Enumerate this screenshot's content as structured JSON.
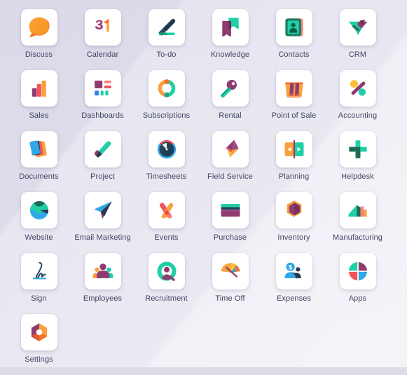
{
  "launcher": {
    "background_color": "#dedbe8",
    "tile_background": "#ffffff",
    "label_color": "#3f4463",
    "columns": 6,
    "apps": [
      {
        "label": "Discuss",
        "icon": "discuss-icon"
      },
      {
        "label": "Calendar",
        "icon": "calendar-icon"
      },
      {
        "label": "To-do",
        "icon": "todo-icon"
      },
      {
        "label": "Knowledge",
        "icon": "knowledge-icon"
      },
      {
        "label": "Contacts",
        "icon": "contacts-icon"
      },
      {
        "label": "CRM",
        "icon": "crm-icon"
      },
      {
        "label": "Sales",
        "icon": "sales-icon"
      },
      {
        "label": "Dashboards",
        "icon": "dashboards-icon"
      },
      {
        "label": "Subscriptions",
        "icon": "subscriptions-icon"
      },
      {
        "label": "Rental",
        "icon": "rental-icon"
      },
      {
        "label": "Point of Sale",
        "icon": "point-of-sale-icon"
      },
      {
        "label": "Accounting",
        "icon": "accounting-icon"
      },
      {
        "label": "Documents",
        "icon": "documents-icon"
      },
      {
        "label": "Project",
        "icon": "project-icon"
      },
      {
        "label": "Timesheets",
        "icon": "timesheets-icon"
      },
      {
        "label": "Field Service",
        "icon": "field-service-icon"
      },
      {
        "label": "Planning",
        "icon": "planning-icon"
      },
      {
        "label": "Helpdesk",
        "icon": "helpdesk-icon"
      },
      {
        "label": "Website",
        "icon": "website-icon"
      },
      {
        "label": "Email Marketing",
        "icon": "email-marketing-icon"
      },
      {
        "label": "Events",
        "icon": "events-icon"
      },
      {
        "label": "Purchase",
        "icon": "purchase-icon"
      },
      {
        "label": "Inventory",
        "icon": "inventory-icon"
      },
      {
        "label": "Manufacturing",
        "icon": "manufacturing-icon"
      },
      {
        "label": "Sign",
        "icon": "sign-icon"
      },
      {
        "label": "Employees",
        "icon": "employees-icon"
      },
      {
        "label": "Recruitment",
        "icon": "recruitment-icon"
      },
      {
        "label": "Time Off",
        "icon": "time-off-icon"
      },
      {
        "label": "Expenses",
        "icon": "expenses-icon"
      },
      {
        "label": "Apps",
        "icon": "apps-icon"
      },
      {
        "label": "Settings",
        "icon": "settings-icon"
      }
    ],
    "palette": {
      "orange": "#f99a34",
      "deep_orange": "#f4722b",
      "purple": "#8f3b6f",
      "magenta": "#a24689",
      "teal": "#21cfa6",
      "green_dark": "#1c6b52",
      "blue": "#30a7e6",
      "navy": "#27364f",
      "red": "#f2545b",
      "yellow": "#fcc03c"
    }
  }
}
